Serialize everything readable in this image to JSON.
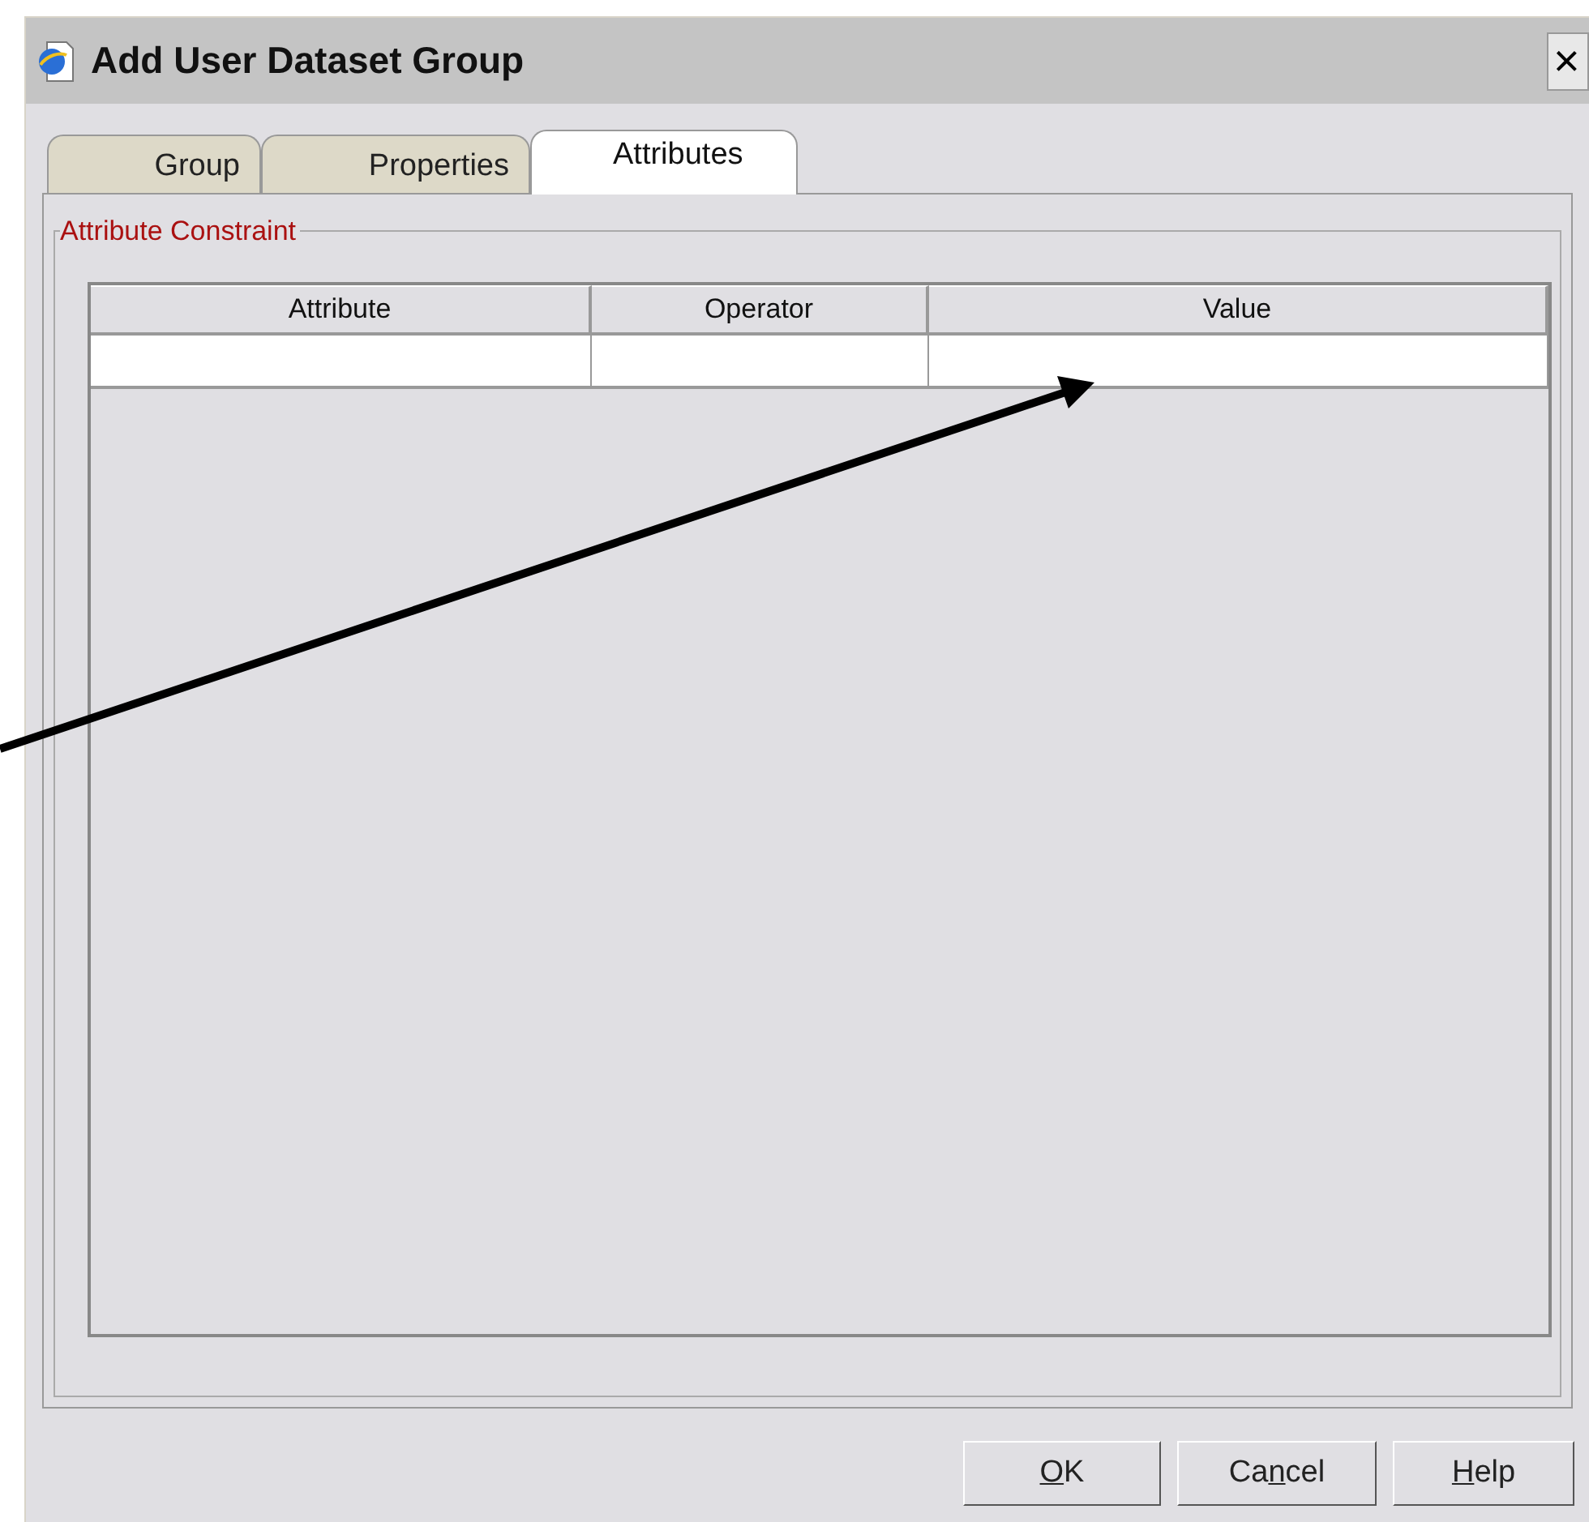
{
  "window": {
    "title": "Add User Dataset Group",
    "close": "×"
  },
  "tabs": [
    {
      "label": "Group",
      "selected": false
    },
    {
      "label": "Properties",
      "selected": false
    },
    {
      "label": "Attributes",
      "selected": true
    }
  ],
  "group_box": {
    "title": "Attribute Constraint"
  },
  "table": {
    "columns": [
      "Attribute",
      "Operator",
      "Value"
    ]
  },
  "buttons": [
    {
      "key": "O",
      "after": "K"
    },
    {
      "before": "Ca",
      "key": "n",
      "after": "cel"
    },
    {
      "key": "H",
      "after": "elp"
    }
  ]
}
